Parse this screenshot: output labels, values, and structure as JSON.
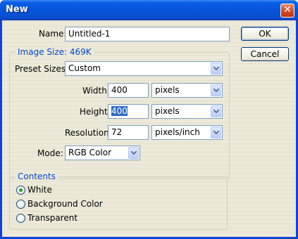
{
  "window": {
    "title": "New",
    "close_icon": "close-icon"
  },
  "buttons": {
    "ok": "OK",
    "cancel": "Cancel"
  },
  "name": {
    "label": "Name:",
    "value": "Untitled-1"
  },
  "image_size": {
    "label": "Image Size: 469K"
  },
  "preset": {
    "label": "Preset Sizes:",
    "value": "Custom"
  },
  "width": {
    "label": "Width:",
    "value": "400",
    "unit": "pixels"
  },
  "height": {
    "label": "Height:",
    "value": "400",
    "unit": "pixels"
  },
  "resolution": {
    "label": "Resolution:",
    "value": "72",
    "unit": "pixels/inch"
  },
  "mode": {
    "label": "Mode:",
    "value": "RGB Color"
  },
  "contents": {
    "label": "Contents",
    "options": [
      "White",
      "Background Color",
      "Transparent"
    ],
    "selected": "White"
  },
  "colors": {
    "titlebar": "#0553d6",
    "dialog_bg": "#ece9d8",
    "legend": "#0046d5",
    "selection": "#316ac5"
  }
}
